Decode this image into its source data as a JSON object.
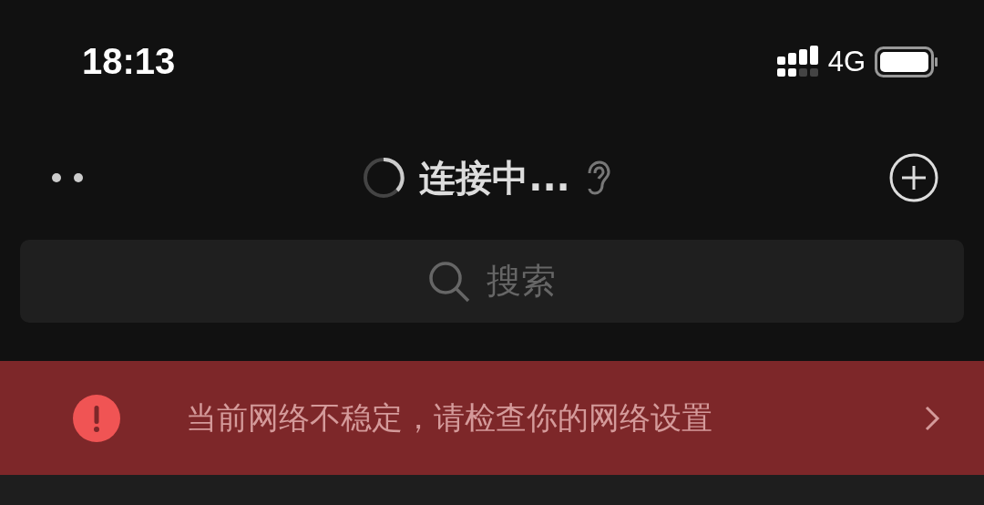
{
  "status_bar": {
    "time": "18:13",
    "network": "4G"
  },
  "nav_bar": {
    "title": "连接中..."
  },
  "search": {
    "placeholder": "搜索"
  },
  "banner": {
    "message": "当前网络不稳定，请检查你的网络设置"
  }
}
